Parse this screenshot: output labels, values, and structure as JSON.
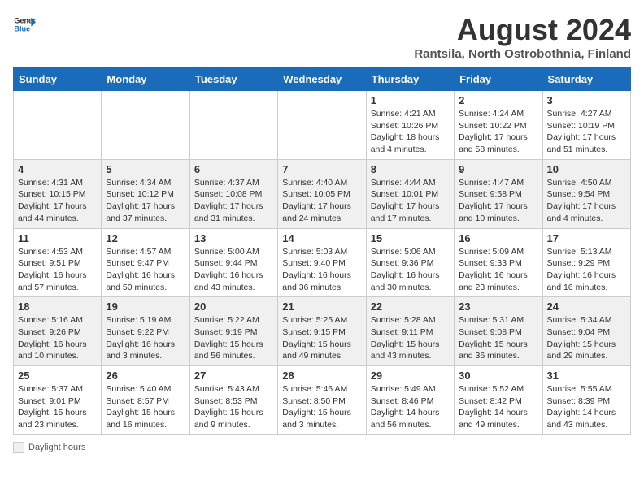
{
  "header": {
    "logo_general": "General",
    "logo_blue": "Blue",
    "month_year": "August 2024",
    "location": "Rantsila, North Ostrobothnia, Finland"
  },
  "weekdays": [
    "Sunday",
    "Monday",
    "Tuesday",
    "Wednesday",
    "Thursday",
    "Friday",
    "Saturday"
  ],
  "weeks": [
    [
      {
        "day": "",
        "info": ""
      },
      {
        "day": "",
        "info": ""
      },
      {
        "day": "",
        "info": ""
      },
      {
        "day": "",
        "info": ""
      },
      {
        "day": "1",
        "info": "Sunrise: 4:21 AM\nSunset: 10:26 PM\nDaylight: 18 hours\nand 4 minutes."
      },
      {
        "day": "2",
        "info": "Sunrise: 4:24 AM\nSunset: 10:22 PM\nDaylight: 17 hours\nand 58 minutes."
      },
      {
        "day": "3",
        "info": "Sunrise: 4:27 AM\nSunset: 10:19 PM\nDaylight: 17 hours\nand 51 minutes."
      }
    ],
    [
      {
        "day": "4",
        "info": "Sunrise: 4:31 AM\nSunset: 10:15 PM\nDaylight: 17 hours\nand 44 minutes."
      },
      {
        "day": "5",
        "info": "Sunrise: 4:34 AM\nSunset: 10:12 PM\nDaylight: 17 hours\nand 37 minutes."
      },
      {
        "day": "6",
        "info": "Sunrise: 4:37 AM\nSunset: 10:08 PM\nDaylight: 17 hours\nand 31 minutes."
      },
      {
        "day": "7",
        "info": "Sunrise: 4:40 AM\nSunset: 10:05 PM\nDaylight: 17 hours\nand 24 minutes."
      },
      {
        "day": "8",
        "info": "Sunrise: 4:44 AM\nSunset: 10:01 PM\nDaylight: 17 hours\nand 17 minutes."
      },
      {
        "day": "9",
        "info": "Sunrise: 4:47 AM\nSunset: 9:58 PM\nDaylight: 17 hours\nand 10 minutes."
      },
      {
        "day": "10",
        "info": "Sunrise: 4:50 AM\nSunset: 9:54 PM\nDaylight: 17 hours\nand 4 minutes."
      }
    ],
    [
      {
        "day": "11",
        "info": "Sunrise: 4:53 AM\nSunset: 9:51 PM\nDaylight: 16 hours\nand 57 minutes."
      },
      {
        "day": "12",
        "info": "Sunrise: 4:57 AM\nSunset: 9:47 PM\nDaylight: 16 hours\nand 50 minutes."
      },
      {
        "day": "13",
        "info": "Sunrise: 5:00 AM\nSunset: 9:44 PM\nDaylight: 16 hours\nand 43 minutes."
      },
      {
        "day": "14",
        "info": "Sunrise: 5:03 AM\nSunset: 9:40 PM\nDaylight: 16 hours\nand 36 minutes."
      },
      {
        "day": "15",
        "info": "Sunrise: 5:06 AM\nSunset: 9:36 PM\nDaylight: 16 hours\nand 30 minutes."
      },
      {
        "day": "16",
        "info": "Sunrise: 5:09 AM\nSunset: 9:33 PM\nDaylight: 16 hours\nand 23 minutes."
      },
      {
        "day": "17",
        "info": "Sunrise: 5:13 AM\nSunset: 9:29 PM\nDaylight: 16 hours\nand 16 minutes."
      }
    ],
    [
      {
        "day": "18",
        "info": "Sunrise: 5:16 AM\nSunset: 9:26 PM\nDaylight: 16 hours\nand 10 minutes."
      },
      {
        "day": "19",
        "info": "Sunrise: 5:19 AM\nSunset: 9:22 PM\nDaylight: 16 hours\nand 3 minutes."
      },
      {
        "day": "20",
        "info": "Sunrise: 5:22 AM\nSunset: 9:19 PM\nDaylight: 15 hours\nand 56 minutes."
      },
      {
        "day": "21",
        "info": "Sunrise: 5:25 AM\nSunset: 9:15 PM\nDaylight: 15 hours\nand 49 minutes."
      },
      {
        "day": "22",
        "info": "Sunrise: 5:28 AM\nSunset: 9:11 PM\nDaylight: 15 hours\nand 43 minutes."
      },
      {
        "day": "23",
        "info": "Sunrise: 5:31 AM\nSunset: 9:08 PM\nDaylight: 15 hours\nand 36 minutes."
      },
      {
        "day": "24",
        "info": "Sunrise: 5:34 AM\nSunset: 9:04 PM\nDaylight: 15 hours\nand 29 minutes."
      }
    ],
    [
      {
        "day": "25",
        "info": "Sunrise: 5:37 AM\nSunset: 9:01 PM\nDaylight: 15 hours\nand 23 minutes."
      },
      {
        "day": "26",
        "info": "Sunrise: 5:40 AM\nSunset: 8:57 PM\nDaylight: 15 hours\nand 16 minutes."
      },
      {
        "day": "27",
        "info": "Sunrise: 5:43 AM\nSunset: 8:53 PM\nDaylight: 15 hours\nand 9 minutes."
      },
      {
        "day": "28",
        "info": "Sunrise: 5:46 AM\nSunset: 8:50 PM\nDaylight: 15 hours\nand 3 minutes."
      },
      {
        "day": "29",
        "info": "Sunrise: 5:49 AM\nSunset: 8:46 PM\nDaylight: 14 hours\nand 56 minutes."
      },
      {
        "day": "30",
        "info": "Sunrise: 5:52 AM\nSunset: 8:42 PM\nDaylight: 14 hours\nand 49 minutes."
      },
      {
        "day": "31",
        "info": "Sunrise: 5:55 AM\nSunset: 8:39 PM\nDaylight: 14 hours\nand 43 minutes."
      }
    ]
  ],
  "legend": {
    "daylight_label": "Daylight hours"
  }
}
